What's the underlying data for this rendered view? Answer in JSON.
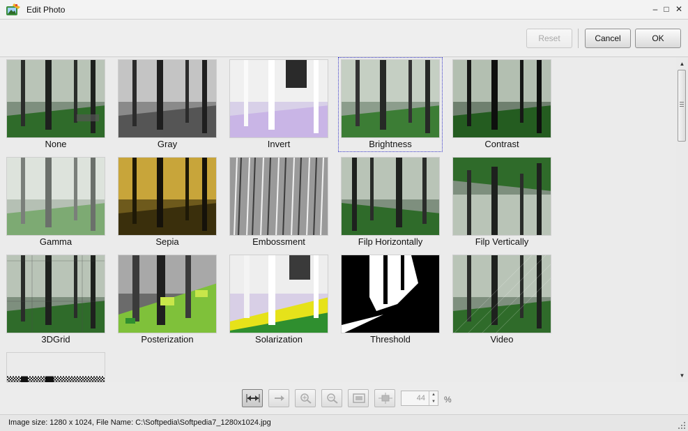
{
  "window": {
    "title": "Edit Photo",
    "minimize_glyph": "–",
    "maximize_glyph": "□",
    "close_glyph": "✕"
  },
  "toolbar": {
    "reset_label": "Reset",
    "cancel_label": "Cancel",
    "ok_label": "OK"
  },
  "effects": [
    {
      "label": "None"
    },
    {
      "label": "Gray"
    },
    {
      "label": "Invert"
    },
    {
      "label": "Brightness",
      "selected": true
    },
    {
      "label": "Contrast"
    },
    {
      "label": "Gamma"
    },
    {
      "label": "Sepia"
    },
    {
      "label": "Embossment"
    },
    {
      "label": "Filp Horizontally"
    },
    {
      "label": "Filp Vertically"
    },
    {
      "label": "3DGrid"
    },
    {
      "label": "Posterization"
    },
    {
      "label": "Solarization"
    },
    {
      "label": "Threshold"
    },
    {
      "label": "Video"
    },
    {
      "label": ""
    }
  ],
  "zoom": {
    "value": "44",
    "unit": "%",
    "buttons": [
      "fit-width-icon",
      "next-icon",
      "zoom-in-icon",
      "zoom-out-icon",
      "fit-window-icon",
      "actual-size-icon"
    ]
  },
  "status": {
    "text": "Image size: 1280 x 1024, File Name: C:\\Softpedia\\Softpedia7_1280x1024.jpg"
  },
  "colors": {
    "selection_outline": "#3a3acb",
    "forest_green": "#2f6b2a",
    "sepia": "#c8a53a",
    "invert_lilac": "#c9b5e6"
  }
}
